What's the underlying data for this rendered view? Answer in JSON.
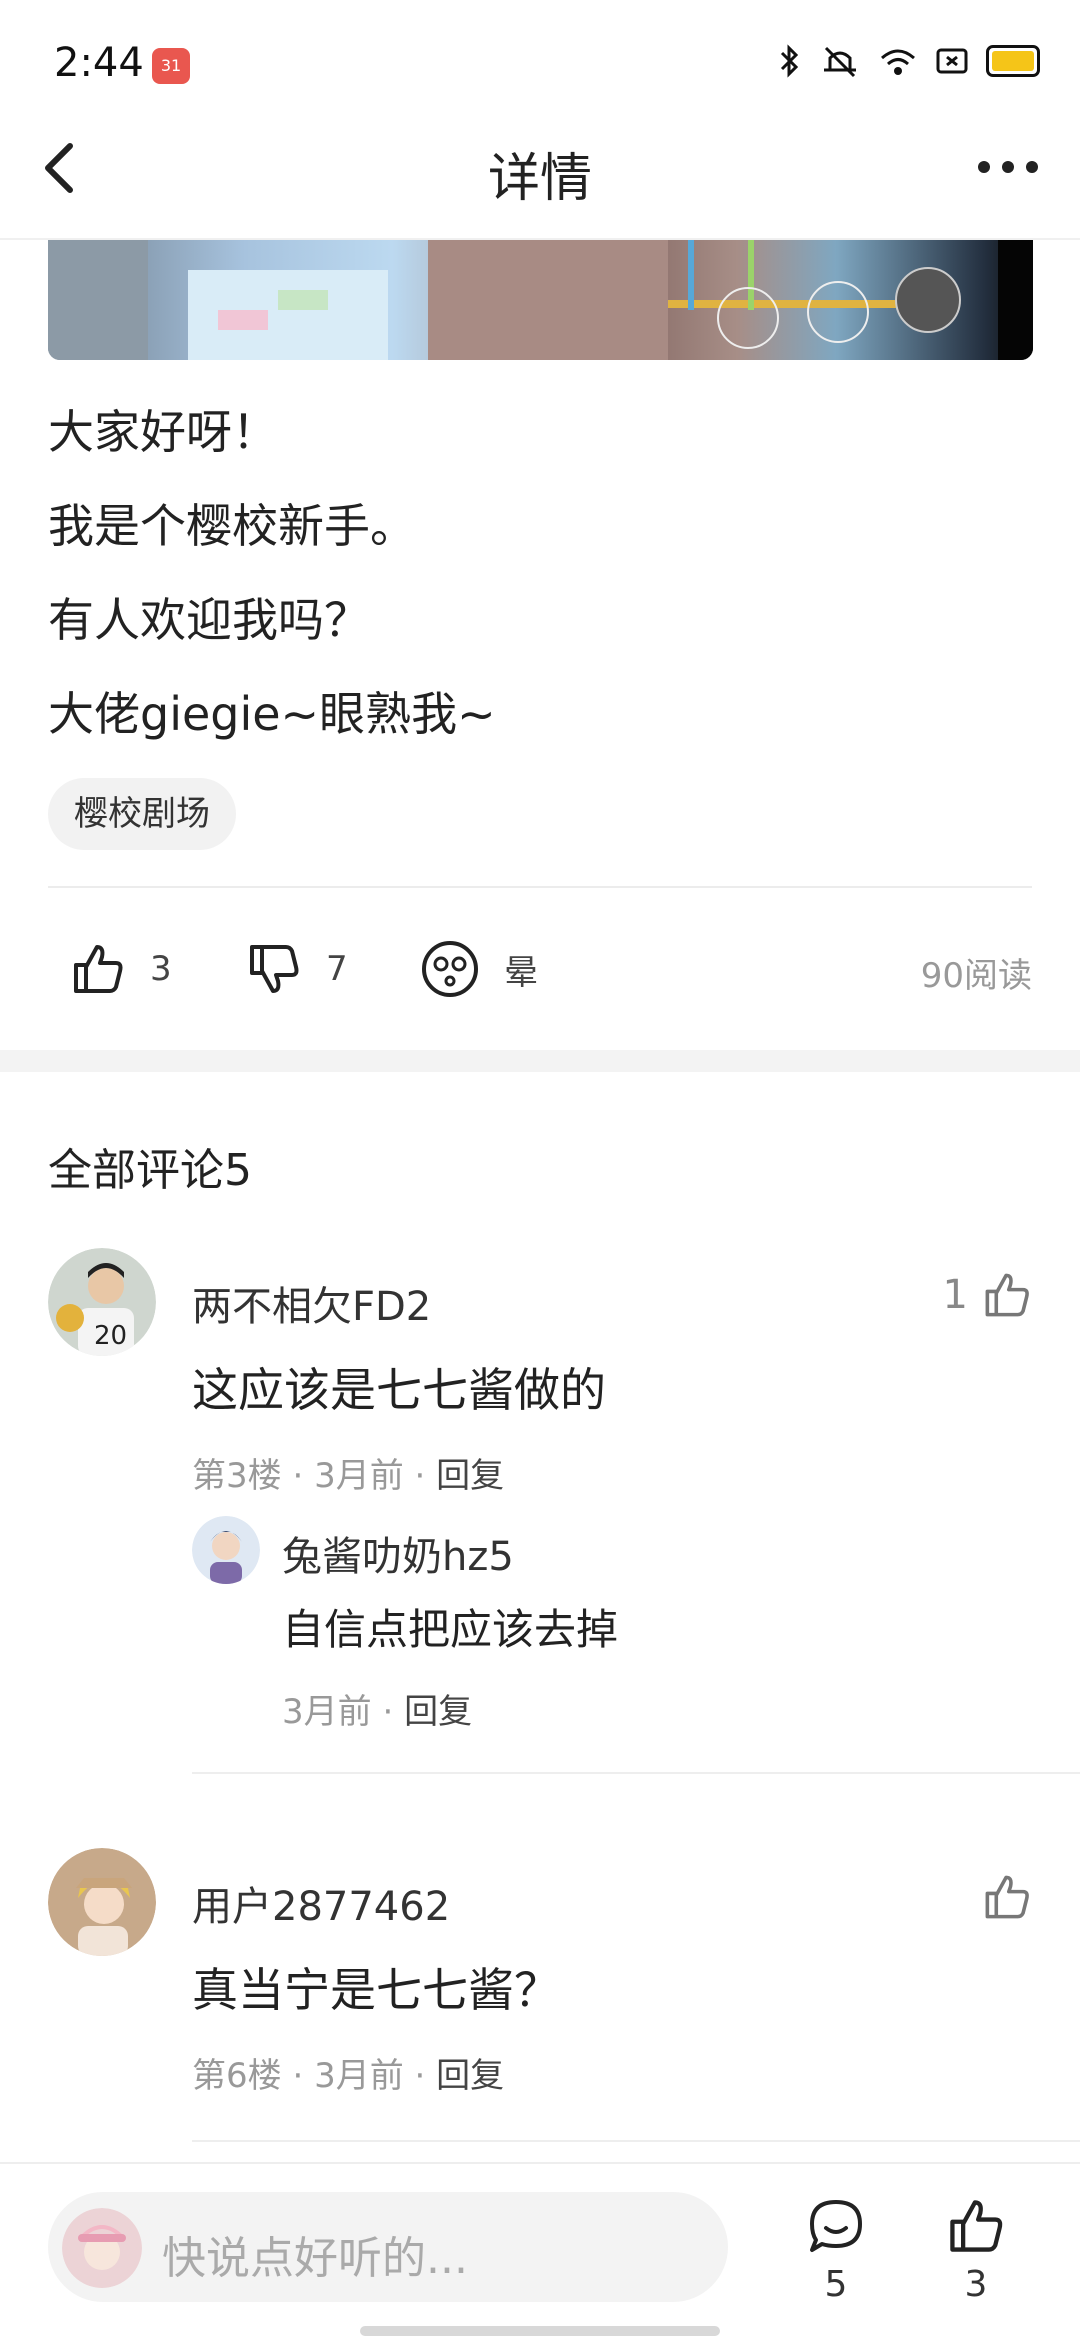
{
  "status_bar": {
    "time": "2:44",
    "calendar_badge": "31"
  },
  "header": {
    "title": "详情"
  },
  "post": {
    "lines": [
      "大家好呀！",
      "我是个樱校新手。",
      "有人欢迎我吗？",
      "大佬giegie~眼熟我~"
    ],
    "tag": "樱校剧场",
    "reactions": {
      "like_count": "3",
      "dislike_count": "7",
      "dizzy_label": "晕"
    },
    "reads": "90阅读"
  },
  "comments_section": {
    "title": "全部评论5",
    "comments": [
      {
        "user": "两不相欠FD2",
        "text": "这应该是七七酱做的",
        "floor": "第3楼",
        "time": "3月前",
        "reply_label": "回复",
        "like_count": "1",
        "sub_reply": {
          "user": "兔酱叻奶hz5",
          "text": "自信点把应该去掉",
          "time": "3月前",
          "reply_label": "回复"
        }
      },
      {
        "user": "用户2877462",
        "text": "真当宁是七七酱？",
        "floor": "第6楼",
        "time": "3月前",
        "reply_label": "回复",
        "like_count": ""
      }
    ],
    "dot": "·"
  },
  "bottom_bar": {
    "placeholder": "快说点好听的...",
    "comment_count": "5",
    "like_count": "3"
  },
  "colors": {
    "calendar_red": "#e9574f",
    "battery_yellow": "#f5c518",
    "meta_gray": "#999999"
  }
}
